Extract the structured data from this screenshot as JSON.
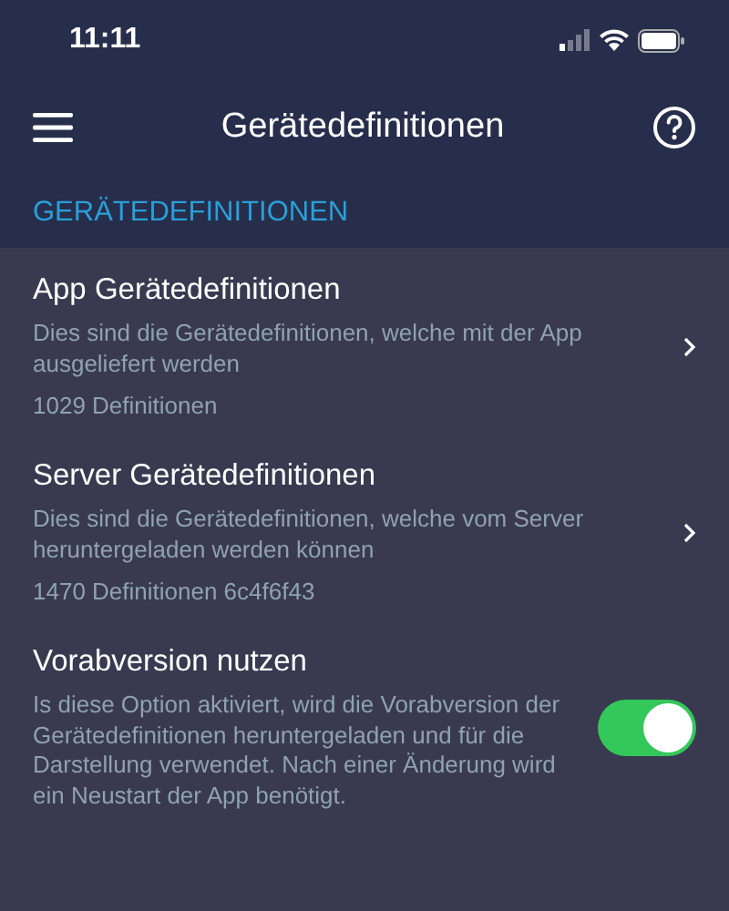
{
  "status_bar": {
    "time": "11:11"
  },
  "header": {
    "title": "Gerätedefinitionen"
  },
  "section": {
    "title": "GERÄTEDEFINITIONEN"
  },
  "items": [
    {
      "kind": "link",
      "title": "App Gerätedefinitionen",
      "description": "Dies sind die Gerätedefinitionen, welche mit der App ausgeliefert werden",
      "detail": "1029 Definitionen"
    },
    {
      "kind": "link",
      "title": "Server Gerätedefinitionen",
      "description": "Dies sind die Gerätedefinitionen, welche vom Server heruntergeladen werden können",
      "detail": "1470 Definitionen 6c4f6f43"
    },
    {
      "kind": "toggle",
      "title": "Vorabversion nutzen",
      "description": "Is diese Option aktiviert, wird die Vorabversion der Gerätedefinitionen heruntergeladen und für die Darstellung verwendet. Nach einer Änderung wird ein Neustart der App benötigt.",
      "on": true
    }
  ]
}
